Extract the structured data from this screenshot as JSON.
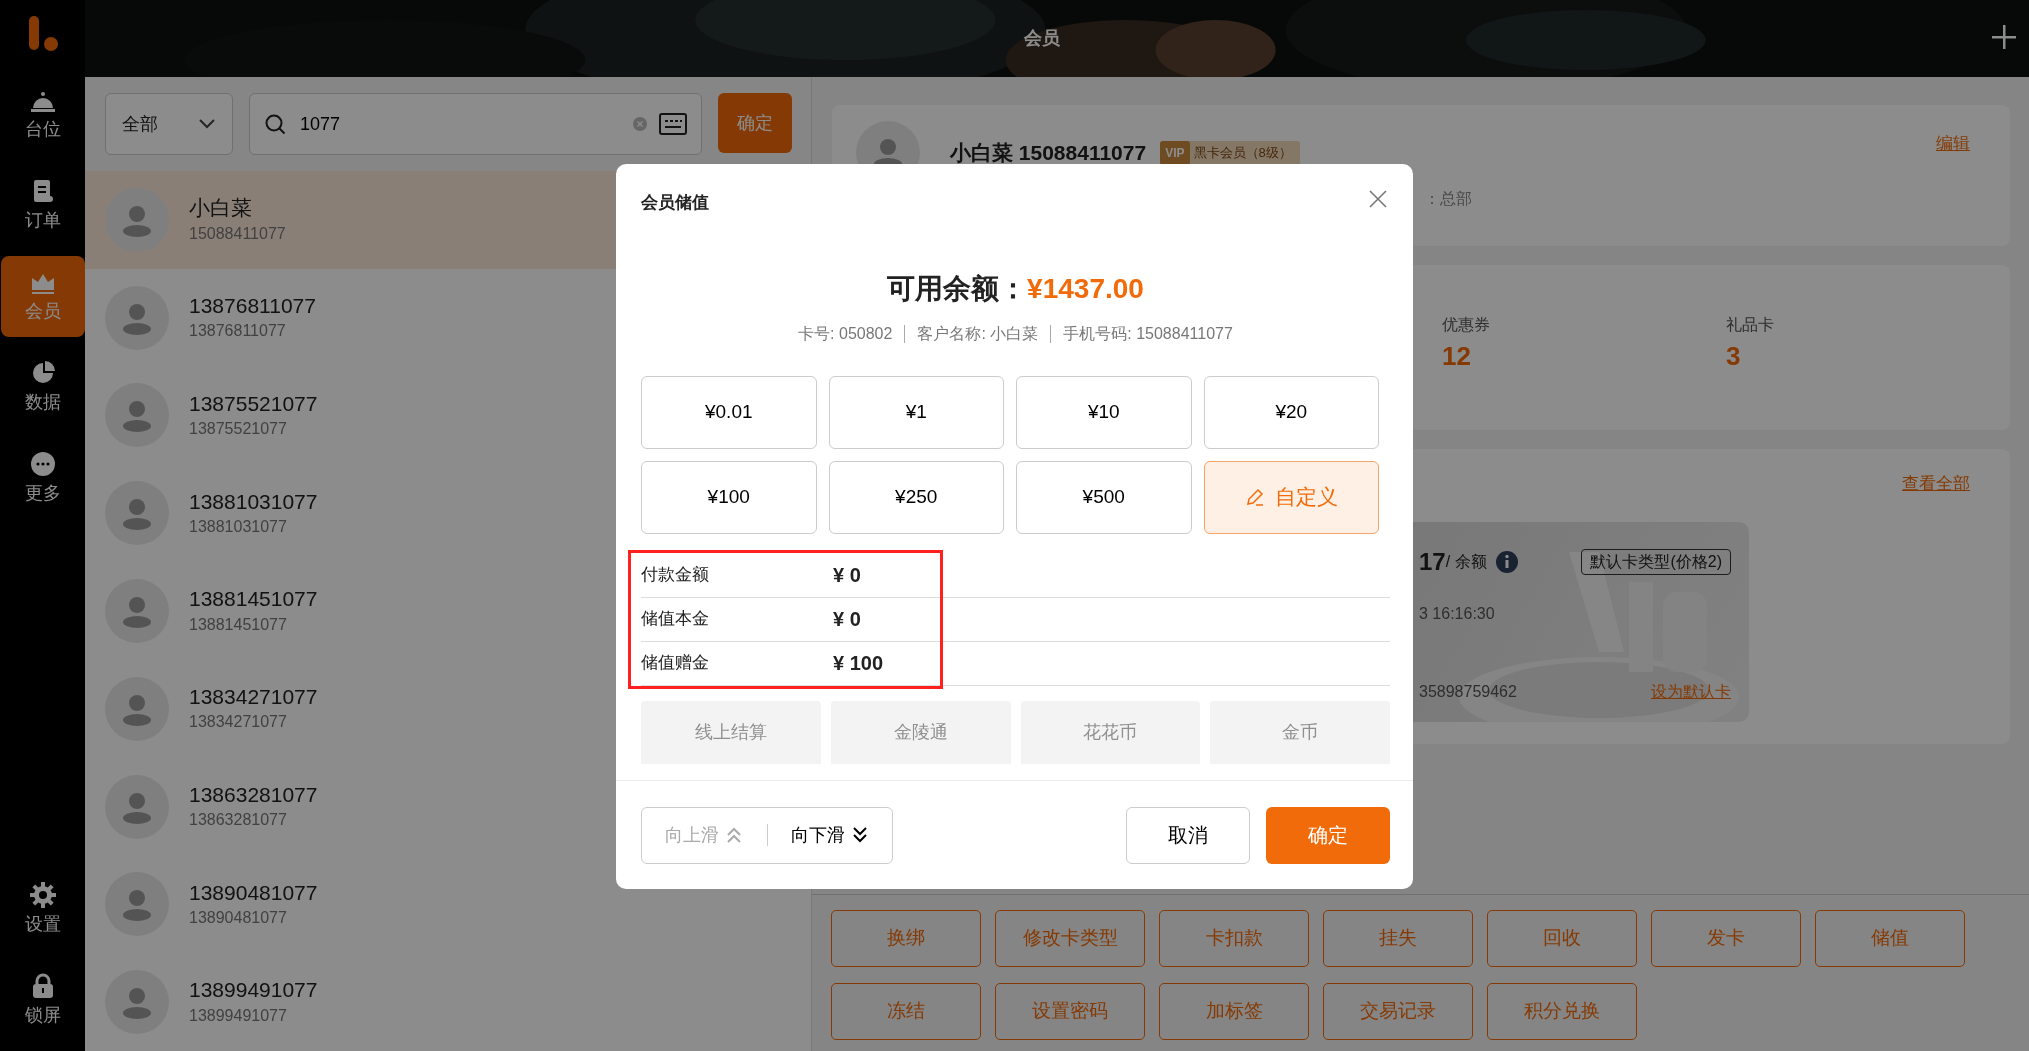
{
  "header": {
    "title": "会员"
  },
  "sidebar": {
    "items": [
      {
        "label": "台位",
        "selected": false
      },
      {
        "label": "订单",
        "selected": false
      },
      {
        "label": "会员",
        "selected": true
      },
      {
        "label": "数据",
        "selected": false
      },
      {
        "label": "更多",
        "selected": false
      }
    ],
    "bottom_items": [
      {
        "label": "设置"
      },
      {
        "label": "锁屏"
      }
    ]
  },
  "filter": {
    "value": "全部"
  },
  "search": {
    "value": "1077"
  },
  "search_button": "确定",
  "members": [
    {
      "name": "小白菜",
      "phone": "15088411077",
      "selected": true
    },
    {
      "name": "13876811077",
      "phone": "13876811077",
      "selected": false
    },
    {
      "name": "13875521077",
      "phone": "13875521077",
      "selected": false
    },
    {
      "name": "13881031077",
      "phone": "13881031077",
      "selected": false
    },
    {
      "name": "13881451077",
      "phone": "13881451077",
      "selected": false
    },
    {
      "name": "13834271077",
      "phone": "13834271077",
      "selected": false
    },
    {
      "name": "13863281077",
      "phone": "13863281077",
      "selected": false
    },
    {
      "name": "13890481077",
      "phone": "13890481077",
      "selected": false
    },
    {
      "name": "13899491077",
      "phone": "13899491077",
      "selected": false
    }
  ],
  "profile": {
    "name": "小白菜 15088411077",
    "vip_badge": "VIP",
    "level": "黑卡会员（8级）",
    "store": "：总部",
    "edit": "编辑"
  },
  "stats": [
    {
      "label": "优惠券",
      "value": "12"
    },
    {
      "label": "礼品卡",
      "value": "3"
    }
  ],
  "cards": {
    "view_all": "查看全部",
    "balance": "17",
    "balance_label": "/ 余额",
    "type_tag": "默认卡类型(价格2)",
    "time": "3 16:16:30",
    "number": "35898759462",
    "set_default": "设为默认卡"
  },
  "actions": [
    "换绑",
    "修改卡类型",
    "卡扣款",
    "挂失",
    "回收",
    "发卡",
    "储值",
    "冻结",
    "设置密码",
    "加标签",
    "交易记录",
    "积分兑换"
  ],
  "dialog": {
    "title": "会员储值",
    "balance_label": "可用余额：",
    "balance": "¥1437.00",
    "info": [
      "卡号: 050802",
      "客户名称: 小白菜",
      "手机号码: 15088411077"
    ],
    "amounts": [
      {
        "label": "¥0.01",
        "kind": "preset",
        "selected": false
      },
      {
        "label": "¥1",
        "kind": "preset",
        "selected": false
      },
      {
        "label": "¥10",
        "kind": "preset",
        "selected": false
      },
      {
        "label": "¥20",
        "kind": "preset",
        "selected": false
      },
      {
        "label": "¥100",
        "kind": "preset",
        "selected": false
      },
      {
        "label": "¥250",
        "kind": "preset",
        "selected": false
      },
      {
        "label": "¥500",
        "kind": "preset",
        "selected": false
      },
      {
        "label": "自定义",
        "kind": "custom",
        "selected": true
      }
    ],
    "summary": [
      {
        "label": "付款金额",
        "value": "¥ 0"
      },
      {
        "label": "储值本金",
        "value": "¥ 0"
      },
      {
        "label": "储值赠金",
        "value": "¥ 100"
      }
    ],
    "summary_highlight": {
      "color": "#ff2020"
    },
    "payment_methods": [
      {
        "label": "线上结算",
        "disabled": true
      },
      {
        "label": "金陵通",
        "disabled": true
      },
      {
        "label": "花花币",
        "disabled": true
      },
      {
        "label": "金币",
        "disabled": true
      }
    ],
    "scroll_up": {
      "label": "向上滑",
      "disabled": true
    },
    "scroll_down": {
      "label": "向下滑",
      "disabled": false
    },
    "cancel": "取消",
    "confirm": "确定"
  }
}
